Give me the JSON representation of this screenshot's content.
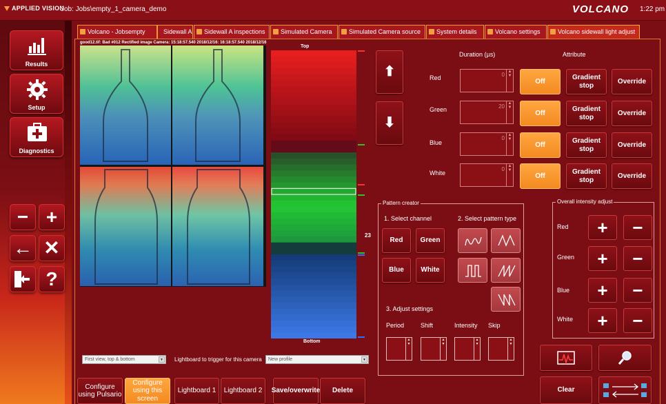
{
  "header": {
    "logo": "APPLIED VISION",
    "job": "Job: Jobs\\empty_1_camera_demo",
    "brand": "VOLCANO",
    "time": "1:22 pm"
  },
  "sidebar": {
    "results": "Results",
    "setup": "Setup",
    "diagnostics": "Diagnostics",
    "minus": "−",
    "plus": "+",
    "back": "←",
    "close": "✕",
    "help": "?"
  },
  "tabs": [
    {
      "label": "Volcano - Jobsempty"
    },
    {
      "label": "Sidewall A"
    },
    {
      "label": "Sidewall A inspections"
    },
    {
      "label": "Simulated Camera"
    },
    {
      "label": "Simulated Camera source"
    },
    {
      "label": "System details"
    },
    {
      "label": "Volcano settings"
    },
    {
      "label": "Volcano sidewall light adjust"
    }
  ],
  "image": {
    "caption": "good12.tif: Bad #012  Rectified image Camera: 15:18:57.540 2018/12/16: 16:18:57.540 2018/12/16"
  },
  "lightboard": {
    "top_label": "Top",
    "bottom_label": "Bottom",
    "row_value": "23"
  },
  "channels": {
    "duration_header": "Duration (µs)",
    "attribute_header": "Attribute",
    "rows": [
      {
        "name": "Red",
        "value": "0",
        "state": "Off",
        "gradient": "Gradient stop",
        "override": "Override"
      },
      {
        "name": "Green",
        "value": "20",
        "state": "Off",
        "gradient": "Gradient stop",
        "override": "Override"
      },
      {
        "name": "Blue",
        "value": "0",
        "state": "Off",
        "gradient": "Gradient stop",
        "override": "Override"
      },
      {
        "name": "White",
        "value": "0",
        "state": "Off",
        "gradient": "Gradient stop",
        "override": "Override"
      }
    ]
  },
  "pattern_creator": {
    "title": "Pattern creator",
    "step1": "1. Select channel",
    "step2": "2. Select pattern type",
    "step3": "3. Adjust settings",
    "red": "Red",
    "green": "Green",
    "blue": "Blue",
    "white": "White",
    "period": "Period",
    "shift": "Shift",
    "intensity": "Intensity",
    "skip": "Skip"
  },
  "overall": {
    "title": "Overall intensity adjust",
    "red": "Red",
    "green": "Green",
    "blue": "Blue",
    "white": "White",
    "plus": "+",
    "minus": "−"
  },
  "bottom": {
    "view_select": "First view, top & bottom",
    "lightboard_label": "Lightboard to trigger for this camera",
    "profile_select": "New profile",
    "configure_pulsario": "Configure using Pulsario",
    "configure_screen": "Configure using this screen",
    "lightboard1": "Lightboard 1",
    "lightboard2": "Lightboard 2",
    "save": "Save/overwrite",
    "delete": "Delete",
    "clear": "Clear"
  },
  "colors": {
    "background": "#7a0e14",
    "accent_orange": "#f39a2e",
    "button_dark": "#6a0a0f"
  }
}
